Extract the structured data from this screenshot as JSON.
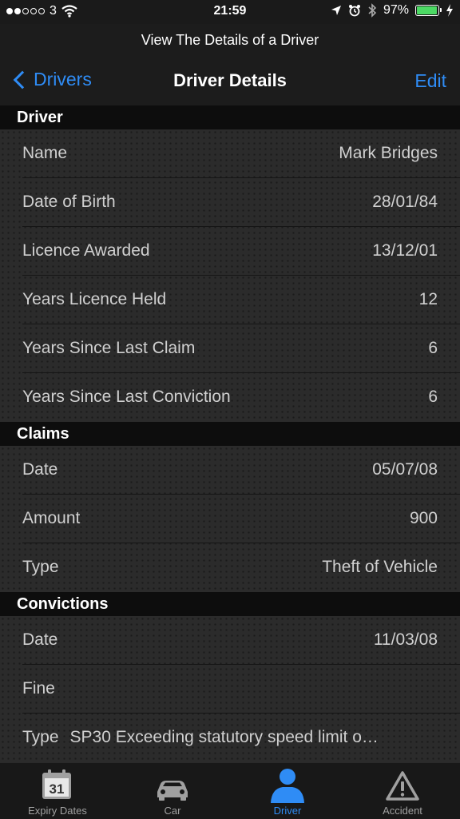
{
  "status_bar": {
    "carrier": "3",
    "time": "21:59",
    "battery_percent": "97%",
    "battery_level": 0.97,
    "signal_filled": 2,
    "signal_total": 5
  },
  "prompt": "View The Details of a Driver",
  "nav": {
    "back_label": "Drivers",
    "title": "Driver Details",
    "edit_label": "Edit"
  },
  "sections": {
    "driver": {
      "header": "Driver",
      "rows": [
        {
          "label": "Name",
          "value": "Mark Bridges"
        },
        {
          "label": "Date of Birth",
          "value": "28/01/84"
        },
        {
          "label": "Licence Awarded",
          "value": "13/12/01"
        },
        {
          "label": "Years Licence Held",
          "value": "12"
        },
        {
          "label": "Years Since Last Claim",
          "value": "6"
        },
        {
          "label": "Years Since Last Conviction",
          "value": "6"
        }
      ]
    },
    "claims": {
      "header": "Claims",
      "rows": [
        {
          "label": "Date",
          "value": "05/07/08"
        },
        {
          "label": "Amount",
          "value": "900"
        },
        {
          "label": "Type",
          "value": "Theft of Vehicle"
        }
      ]
    },
    "convictions": {
      "header": "Convictions",
      "rows": [
        {
          "label": "Date",
          "value": "11/03/08"
        },
        {
          "label": "Fine",
          "value": ""
        },
        {
          "label": "Type",
          "value": "SP30  Exceeding statutory speed limit o…"
        }
      ]
    }
  },
  "tabbar": {
    "tabs": [
      {
        "label": "Expiry Dates",
        "icon": "calendar-icon",
        "calendar_day": "31"
      },
      {
        "label": "Car",
        "icon": "car-icon"
      },
      {
        "label": "Driver",
        "icon": "person-icon"
      },
      {
        "label": "Accident",
        "icon": "warning-icon"
      }
    ],
    "active_index": 2
  },
  "colors": {
    "accent": "#2f8cf5",
    "battery": "#4cd964",
    "section_header_bg": "#0d0d0d",
    "row_bg": "#2b2b2b"
  }
}
